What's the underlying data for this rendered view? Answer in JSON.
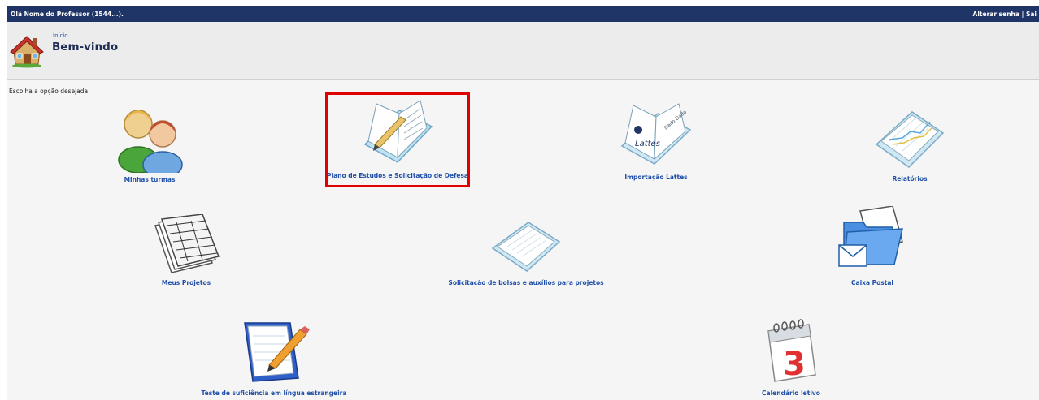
{
  "topbar": {
    "greeting": "Olá Nome do Professor (1544...).",
    "change_password": "Alterar senha",
    "separator": "|",
    "logout": "Sai"
  },
  "header": {
    "breadcrumb": "Início",
    "title": "Bem-vindo",
    "home_icon": "house-icon"
  },
  "main": {
    "prompt": "Escolha a opção desejada:",
    "tiles": [
      {
        "label": "Minhas turmas",
        "icon": "people-icon"
      },
      {
        "label": "Plano de Estudos e Solicitação de Defesa",
        "icon": "notebook-pencil-icon",
        "highlighted": true
      },
      {
        "label": "Importação Lattes",
        "icon": "lattes-book-icon"
      },
      {
        "label": "Relatórios",
        "icon": "report-chart-icon"
      },
      {
        "label": "Meus Projetos",
        "icon": "spreadsheet-stack-icon"
      },
      {
        "label": "Solicitação de bolsas e auxílios para projetos",
        "icon": "document-icon"
      },
      {
        "label": "Caixa Postal",
        "icon": "folder-mail-icon"
      },
      {
        "label": "Teste de suficiência em língua estrangeira",
        "icon": "notepad-pencil-icon"
      },
      {
        "label": "Calendário letivo",
        "icon": "calendar-icon"
      }
    ],
    "calendar_day": "3"
  },
  "colors": {
    "topbar": "#1f3567",
    "link": "#1f4fa8",
    "highlight": "#e00000"
  }
}
